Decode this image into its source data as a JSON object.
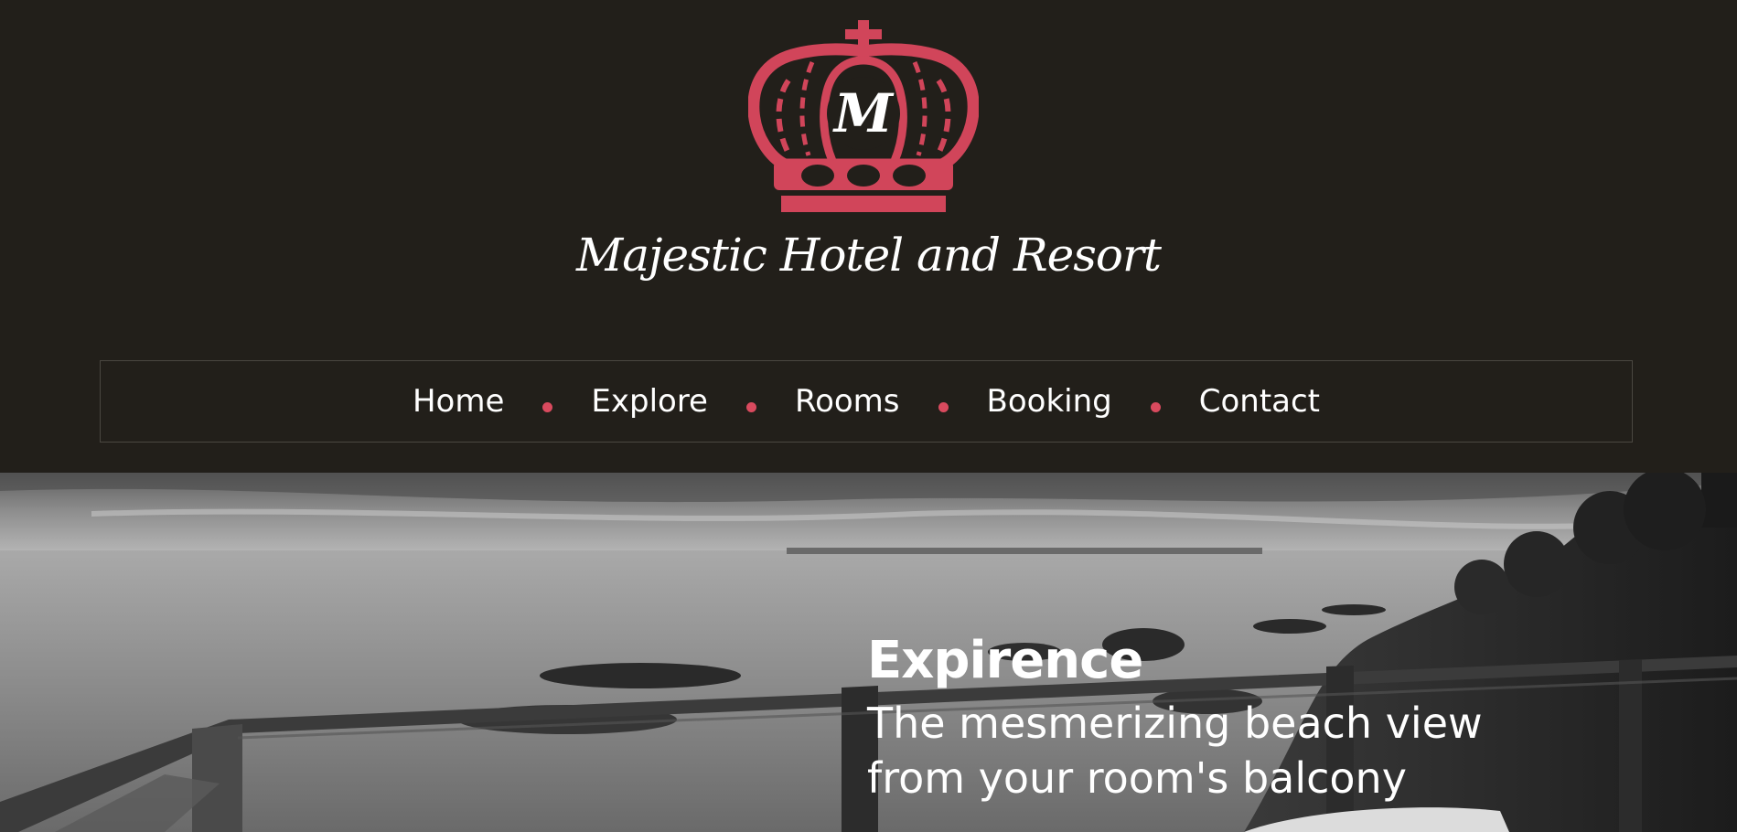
{
  "brand": {
    "name": "Majestic Hotel and Resort",
    "monogram": "M",
    "logo_icon": "crown-icon",
    "accent_color": "#d94a5e",
    "background_color": "#221f1a"
  },
  "nav": {
    "items": [
      {
        "label": "Home"
      },
      {
        "label": "Explore"
      },
      {
        "label": "Rooms"
      },
      {
        "label": "Booking"
      },
      {
        "label": "Contact"
      }
    ],
    "separator_icon": "dot-icon"
  },
  "hero": {
    "image": "beach-balcony-photo",
    "title": "Expirence",
    "subtitle_line1": "The mesmerizing beach view",
    "subtitle_line2": "from your room's balcony"
  }
}
